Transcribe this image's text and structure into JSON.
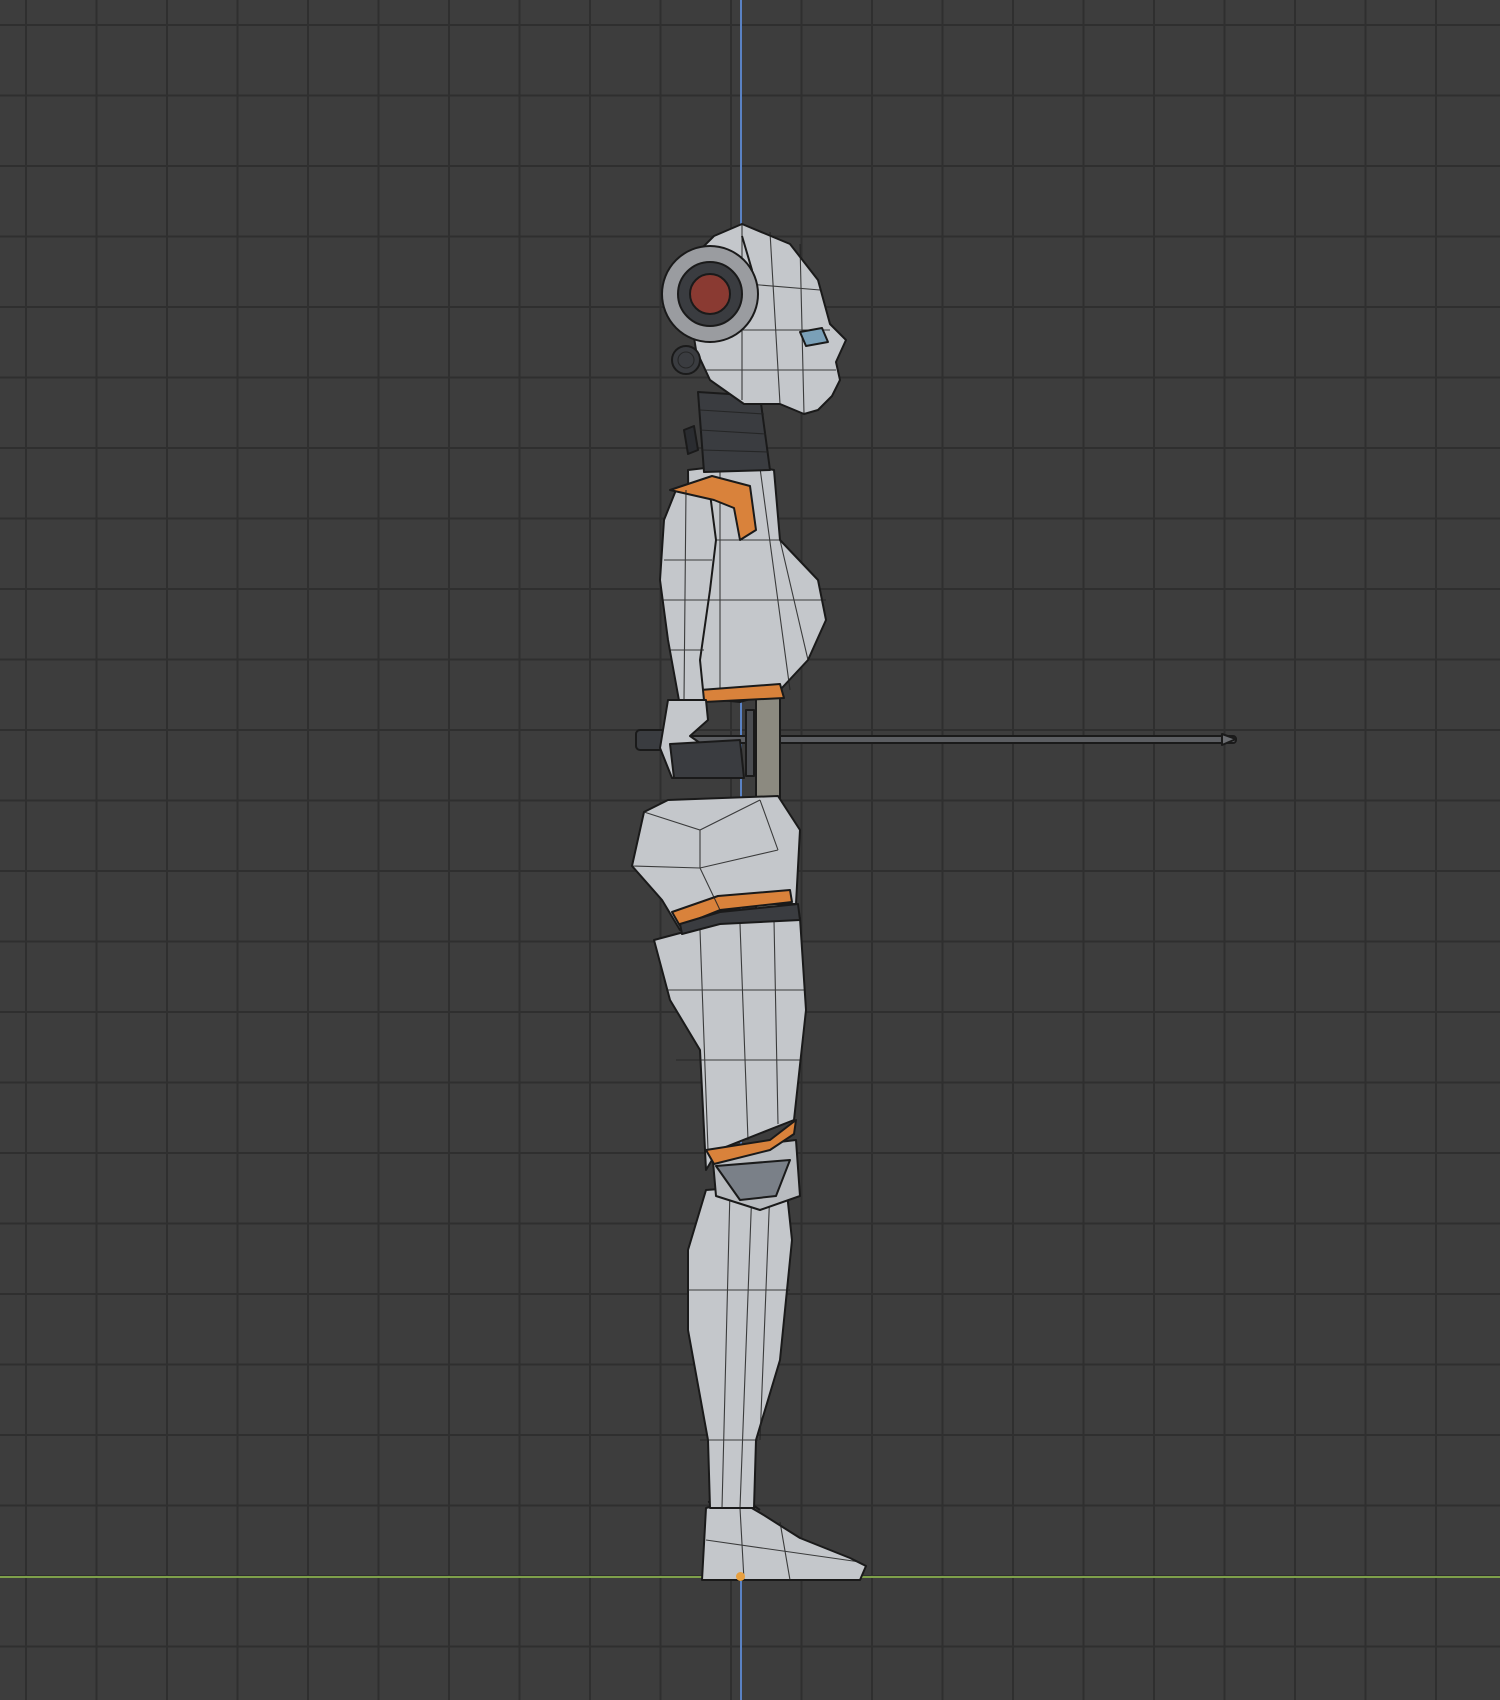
{
  "viewport": {
    "grid_color": "#2f2f2f",
    "background_color": "#3d3d3d",
    "axes": {
      "z_axis_color": "#5a82c4",
      "y_axis_color": "#7ea04a",
      "origin_color": "#e8a040"
    },
    "object": {
      "icon": "armature-mesh-icon",
      "body_color": "#c4c7cb",
      "trim_color": "#d9823b",
      "dark_color": "#3a3c40",
      "eye_accent_color": "#8a3a32",
      "wire_color": "#1a1a1a"
    }
  }
}
